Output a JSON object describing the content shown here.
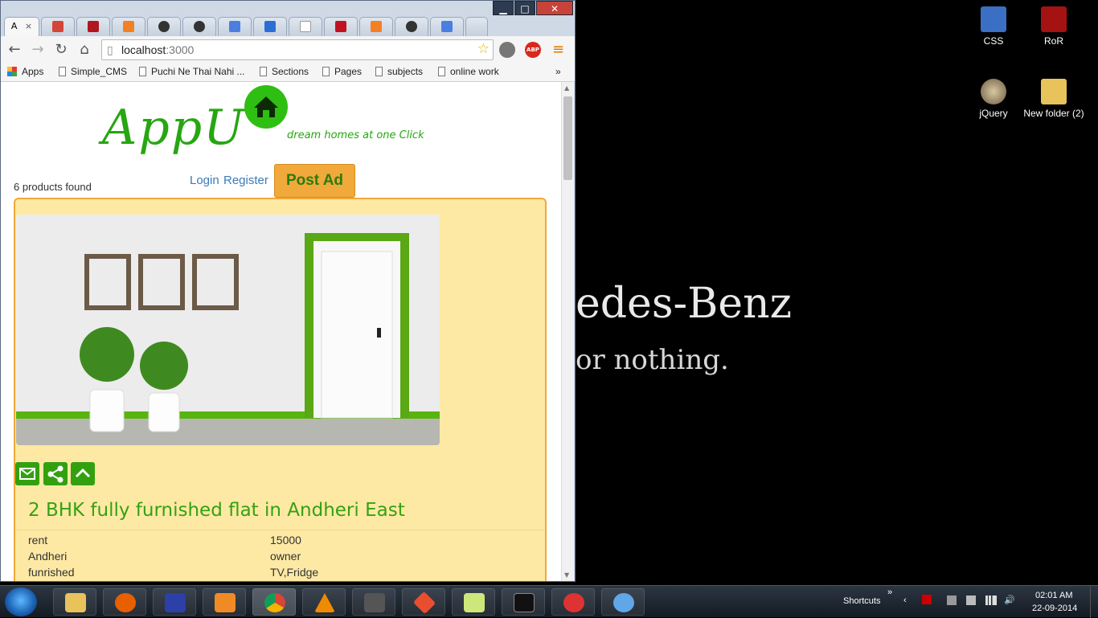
{
  "browser": {
    "tabs": [
      {
        "label": "A",
        "icon": "appu-tab",
        "close": "×",
        "color": "#ffffff"
      },
      {
        "label": "",
        "icon": "gmail-icon",
        "color": "#d44638"
      },
      {
        "label": "",
        "icon": "ruby-icon",
        "color": "#b0171f"
      },
      {
        "label": "",
        "icon": "stackoverflow-icon",
        "color": "#f48024"
      },
      {
        "label": "",
        "icon": "github-icon",
        "color": "#333333"
      },
      {
        "label": "",
        "icon": "github-icon",
        "color": "#333333"
      },
      {
        "label": "",
        "icon": "google-icon",
        "color": "#4a7fe0"
      },
      {
        "label": "",
        "icon": "jb-icon",
        "color": "#2b6fd6"
      },
      {
        "label": "",
        "icon": "page-icon",
        "color": "#cccccc"
      },
      {
        "label": "",
        "icon": "rubygems-icon",
        "color": "#c1121f"
      },
      {
        "label": "",
        "icon": "stackoverflow-icon",
        "color": "#f48024"
      },
      {
        "label": "",
        "icon": "github-icon",
        "color": "#333333"
      },
      {
        "label": "",
        "icon": "google-icon",
        "color": "#4a7fe0"
      }
    ],
    "window_controls": {
      "minimize": "▁",
      "maximize": "□",
      "close": "✕"
    },
    "address": {
      "host": "localhost",
      "port": ":3000"
    },
    "bookmarks": {
      "apps": "Apps",
      "items": [
        "Simple_CMS",
        "Puchi Ne Thai Nahi ...",
        "Sections",
        "Pages",
        "subjects",
        "online work"
      ],
      "overflow": "»"
    }
  },
  "page": {
    "logo": "AppU",
    "tagline": "dream homes at one Click",
    "products_found": "6 products found",
    "login": "Login",
    "register": "Register",
    "post_ad": "Post Ad",
    "listing": {
      "title": "2 BHK fully furnished flat in Andheri East",
      "rows": [
        {
          "left": "rent",
          "right": "15000"
        },
        {
          "left": "Andheri",
          "right": "owner"
        },
        {
          "left": "funrished",
          "right": "TV,Fridge"
        }
      ]
    }
  },
  "desktop": {
    "wallpaper_line1": "edes-Benz",
    "wallpaper_line2": "or nothing.",
    "icons": [
      {
        "label": "CSS",
        "color": "#3a6fc4"
      },
      {
        "label": "RoR",
        "color": "#a51212"
      },
      {
        "label": "jQuery",
        "color": "#8a7a60"
      },
      {
        "label": "New folder (2)",
        "color": "#e8c25a"
      }
    ]
  },
  "taskbar": {
    "apps": [
      {
        "name": "explorer",
        "color": "#e8c25a"
      },
      {
        "name": "firefox",
        "color": "#e66000"
      },
      {
        "name": "media",
        "color": "#2d3fa8"
      },
      {
        "name": "player",
        "color": "#f08a24"
      },
      {
        "name": "chrome",
        "color": "#4caf50"
      },
      {
        "name": "vlc",
        "color": "#f08a00"
      },
      {
        "name": "sublime",
        "color": "#555555"
      },
      {
        "name": "git",
        "color": "#e94e31"
      },
      {
        "name": "stickynotes",
        "color": "#cde77a"
      },
      {
        "name": "cmd",
        "color": "#111111"
      },
      {
        "name": "snipping",
        "color": "#d33"
      },
      {
        "name": "paint",
        "color": "#5fa7e8"
      }
    ],
    "shortcuts": "Shortcuts",
    "time": "02:01 AM",
    "date": "22-09-2014"
  }
}
